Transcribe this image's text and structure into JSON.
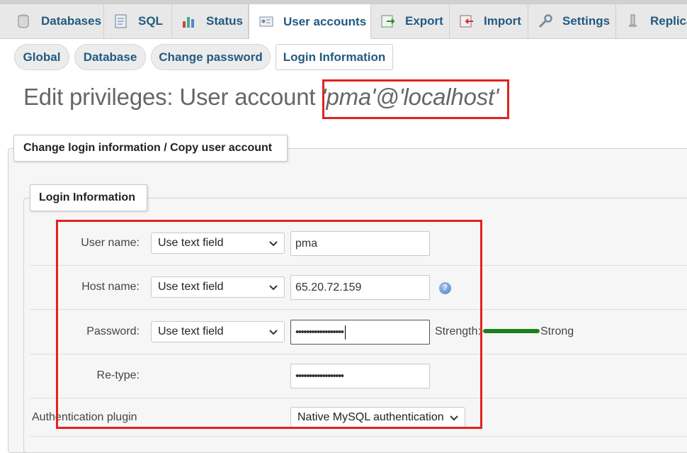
{
  "tabs": [
    {
      "label": "Databases",
      "icon": "database-icon"
    },
    {
      "label": "SQL",
      "icon": "sql-icon"
    },
    {
      "label": "Status",
      "icon": "status-icon"
    },
    {
      "label": "User accounts",
      "icon": "user-accounts-icon",
      "active": true
    },
    {
      "label": "Export",
      "icon": "export-icon"
    },
    {
      "label": "Import",
      "icon": "import-icon"
    },
    {
      "label": "Settings",
      "icon": "wrench-icon"
    },
    {
      "label": "Replica",
      "icon": "replication-icon"
    }
  ],
  "subnav": [
    {
      "label": "Global"
    },
    {
      "label": "Database"
    },
    {
      "label": "Change password"
    },
    {
      "label": "Login Information",
      "active": true
    }
  ],
  "page": {
    "title_prefix": "Edit privileges: User account ",
    "account": "'pma'@'localhost'"
  },
  "outer_legend": "Change login information / Copy user account",
  "inner_legend": "Login Information",
  "form": {
    "username": {
      "label": "User name:",
      "mode": "Use text field",
      "value": "pma"
    },
    "hostname": {
      "label": "Host name:",
      "mode": "Use text field",
      "value": "65.20.72.159"
    },
    "password": {
      "label": "Password:",
      "mode": "Use text field",
      "value": "••••••••••••••••••",
      "strength_label": "Strength:",
      "strength_value": "Strong",
      "strength_level": 1.0
    },
    "retype": {
      "label": "Re-type:",
      "value": "••••••••••••••••••"
    },
    "auth_plugin": {
      "label": "Authentication plugin",
      "value": "Native MySQL authentication"
    }
  },
  "colors": {
    "link": "#235a81",
    "highlight": "#e0231f",
    "strength_strong": "#1c7f1c"
  }
}
